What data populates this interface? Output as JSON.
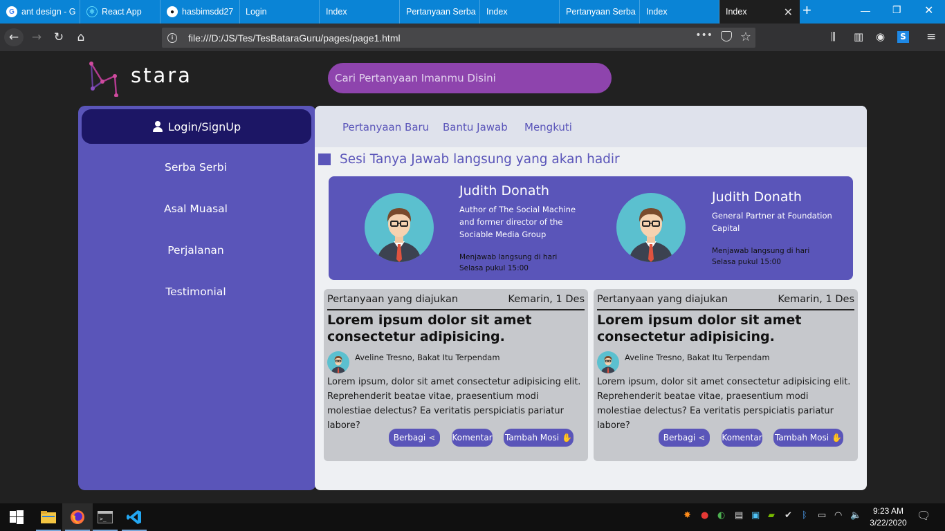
{
  "browser": {
    "tabs": [
      {
        "label": "ant design - G",
        "icon": "google-icon"
      },
      {
        "label": "React App",
        "icon": "react-icon"
      },
      {
        "label": "hasbimsdd27",
        "icon": "github-icon"
      },
      {
        "label": "Login",
        "icon": ""
      },
      {
        "label": "Index",
        "icon": ""
      },
      {
        "label": "Pertanyaan Serba",
        "icon": ""
      },
      {
        "label": "Index",
        "icon": ""
      },
      {
        "label": "Pertanyaan Serba",
        "icon": ""
      },
      {
        "label": "Index",
        "icon": ""
      },
      {
        "label": "Index",
        "icon": "",
        "active": true
      }
    ],
    "url": "file:///D:/JS/Tes/TesBataraGuru/pages/page1.html",
    "accent": "#0a84d6"
  },
  "header": {
    "brand": "stara",
    "search_placeholder": "Cari Pertanyaan Imanmu Disini"
  },
  "sidebar": {
    "login_label": "Login/SignUp",
    "items": [
      {
        "label": "Serba Serbi"
      },
      {
        "label": "Asal Muasal"
      },
      {
        "label": "Perjalanan"
      },
      {
        "label": "Testimonial"
      }
    ]
  },
  "main": {
    "tabs": [
      {
        "label": "Pertanyaan Baru"
      },
      {
        "label": "Bantu Jawab"
      },
      {
        "label": "Mengkuti"
      }
    ],
    "section_title": "Sesi Tanya Jawab langsung yang akan hadir",
    "speakers": [
      {
        "name": "Judith Donath",
        "role_lines": [
          "Author of The Social Machine",
          "and former director of the",
          "Sociable Media Group"
        ],
        "schedule_lines": [
          "Menjawab langsung di hari",
          "Selasa pukul 15:00"
        ]
      },
      {
        "name": "Judith Donath",
        "role_lines": [
          "General Partner at Foundation",
          "Capital"
        ],
        "schedule_lines": [
          "Menjawab langsung di hari",
          "Selasa pukul 15:00"
        ]
      }
    ],
    "questions": [
      {
        "header": "Pertanyaan yang diajukan",
        "date": "Kemarin, 1 Des",
        "title": "Lorem ipsum dolor sit amet consectetur adipisicing.",
        "author": "Aveline Tresno, Bakat Itu Terpendam",
        "body": "Lorem ipsum, dolor sit amet consectetur adipisicing elit. Reprehenderit beatae vitae, praesentium modi molestiae delectus? Ea veritatis perspiciatis pariatur labore?",
        "share_label": "Berbagi",
        "comment_label": "Komentar",
        "vote_label": "Tambah Mosi"
      },
      {
        "header": "Pertanyaan yang diajukan",
        "date": "Kemarin, 1 Des",
        "title": "Lorem ipsum dolor sit amet consectetur adipisicing.",
        "author": "Aveline Tresno, Bakat Itu Terpendam",
        "body": "Lorem ipsum, dolor sit amet consectetur adipisicing elit. Reprehenderit beatae vitae, praesentium modi molestiae delectus? Ea veritatis perspiciatis pariatur labore?",
        "share_label": "Berbagi",
        "comment_label": "Komentar",
        "vote_label": "Tambah Mosi"
      }
    ]
  },
  "colors": {
    "primary": "#5a55b9",
    "dark_primary": "#1c1665",
    "search_bg": "#8e44ad"
  },
  "taskbar": {
    "time": "9:23 AM",
    "date": "3/22/2020"
  }
}
